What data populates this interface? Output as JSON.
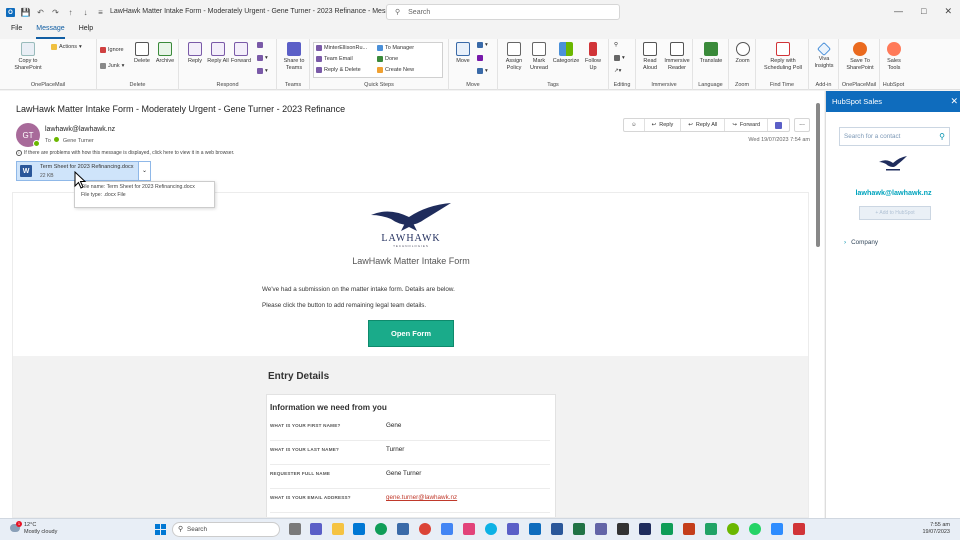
{
  "window": {
    "title": "LawHawk Matter Intake Form - Moderately Urgent - Gene Turner - 2023 Refinance  -  Message (HT...",
    "search_placeholder": "Search"
  },
  "menu": {
    "file": "File",
    "message": "Message",
    "help": "Help"
  },
  "ribbon": {
    "copy_to_sharepoint": "Copy to SharePoint",
    "onePlaceMail": "OnePlaceMail",
    "actions": "Actions",
    "ignore": "Ignore",
    "junk": "Junk",
    "delete": "Delete",
    "archive": "Archive",
    "delete_group": "Delete",
    "reply": "Reply",
    "reply_all": "Reply All",
    "forward": "Forward",
    "respond_group": "Respond",
    "share_to_teams": "Share to Teams",
    "teams_group": "Teams",
    "qs_1": "MinterEllisonRu...",
    "qs_2": "Team Email",
    "qs_3": "Reply & Delete",
    "qs_4": "To Manager",
    "qs_5": "Done",
    "qs_6": "Create New",
    "quicksteps_group": "Quick Steps",
    "move": "Move",
    "move_group": "Move",
    "assign_policy": "Assign Policy",
    "mark_unread": "Mark Unread",
    "categorize": "Categorize",
    "follow_up": "Follow Up",
    "tags_group": "Tags",
    "editing_group": "Editing",
    "read_aloud": "Read Aloud",
    "immersive_reader": "Immersive Reader",
    "immersive_group": "Immersive",
    "translate": "Translate",
    "language_group": "Language",
    "zoom": "Zoom",
    "zoom_group": "Zoom",
    "reply_with_poll": "Reply with Scheduling Poll",
    "findtime_group": "Find Time",
    "viva_insights": "Viva Insights",
    "addin_group": "Add-in",
    "save_to_sharepoint": "Save To SharePoint",
    "onePlaceMail_group": "OnePlaceMail",
    "sales_tools": "Sales Tools",
    "hubspot_group": "HubSpot"
  },
  "message": {
    "subject": "LawHawk Matter Intake Form - Moderately Urgent - Gene Turner - 2023 Refinance",
    "avatar_initials": "GT",
    "from": "lawhawk@lawhawk.nz",
    "to_label": "To",
    "to": "Gene Turner",
    "reply": "Reply",
    "reply_all": "Reply All",
    "forward": "Forward",
    "more": "...",
    "date": "Wed 19/07/2023 7:54 am",
    "info": "If there are problems with how this message is displayed, click here to view it in a web browser.",
    "attachment_name": "Term Sheet for 2023 Refinancing.docx",
    "attachment_size": "22 KB",
    "tooltip_name": "File name:  Term Sheet for 2023 Refinancing.docx",
    "tooltip_type": "File type:  .docx File"
  },
  "body": {
    "logo_text": "LAWHAWK",
    "logo_sub": "TECHNOLOGIES",
    "form_title": "LawHawk Matter Intake Form",
    "line1": "We've had a submission on the matter intake form.  Details are below.",
    "line2": "Please click the button to add remaining legal team details.",
    "open_form": "Open Form",
    "entry_details": "Entry Details",
    "info_heading": "Information we need from you",
    "rows": [
      {
        "q": "WHAT IS YOUR FIRST NAME?",
        "a": "Gene"
      },
      {
        "q": "WHAT IS YOUR LAST NAME?",
        "a": "Turner"
      },
      {
        "q": "REQUESTER FULL NAME",
        "a": "Gene Turner"
      },
      {
        "q": "WHAT IS YOUR EMAIL ADDRESS?",
        "a": "gene.turner@lawhawk.nz"
      }
    ]
  },
  "hubspot": {
    "title": "HubSpot Sales",
    "search_placeholder": "Search for a contact",
    "email": "lawhawk@lawhawk.nz",
    "add_button": "+ Add to HubSpot",
    "company": "Company"
  },
  "taskbar": {
    "temp": "12°C",
    "weather": "Mostly cloudy",
    "badge": "1",
    "search": "Search",
    "time": "7:55 am",
    "date": "19/07/2023"
  },
  "colors": {
    "accent": "#0f6cbd",
    "open_form": "#1aab8a",
    "hubspot_teal": "#00a4bd"
  }
}
